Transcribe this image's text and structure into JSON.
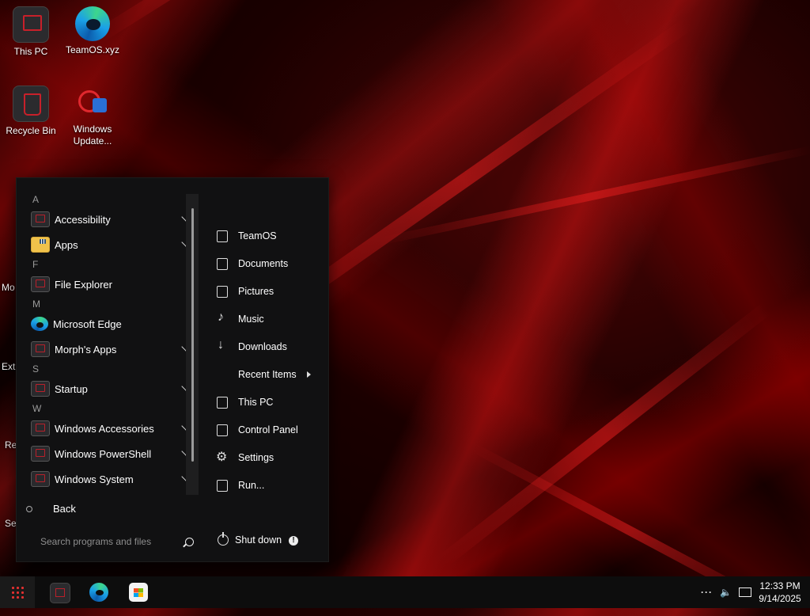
{
  "desktop": {
    "icons": [
      {
        "label": "This PC",
        "icon": "pc-icon"
      },
      {
        "label": "TeamOS.xyz",
        "icon": "edge-icon"
      },
      {
        "label": "Recycle Bin",
        "icon": "recycle-bin-icon"
      },
      {
        "label": "Windows Update...",
        "icon": "windows-update-icon"
      }
    ],
    "partial_labels": [
      "Mo",
      "Extr",
      "Re",
      "Se"
    ]
  },
  "start_menu": {
    "groups": [
      {
        "letter": "A",
        "items": [
          {
            "label": "Accessibility",
            "icon": "folder-icon",
            "expandable": true
          },
          {
            "label": "Apps",
            "icon": "folder-icon",
            "expandable": true
          }
        ]
      },
      {
        "letter": "F",
        "items": [
          {
            "label": "File Explorer",
            "icon": "file-explorer-icon",
            "expandable": false
          }
        ]
      },
      {
        "letter": "M",
        "items": [
          {
            "label": "Microsoft Edge",
            "icon": "edge-icon",
            "expandable": false
          },
          {
            "label": "Morph's Apps",
            "icon": "folder-icon",
            "expandable": true
          }
        ]
      },
      {
        "letter": "S",
        "items": [
          {
            "label": "Startup",
            "icon": "folder-icon",
            "expandable": true
          }
        ]
      },
      {
        "letter": "W",
        "items": [
          {
            "label": "Windows Accessories",
            "icon": "folder-icon",
            "expandable": true
          },
          {
            "label": "Windows PowerShell",
            "icon": "folder-icon",
            "expandable": true
          },
          {
            "label": "Windows System",
            "icon": "folder-icon",
            "expandable": true
          }
        ]
      }
    ],
    "back_label": "Back",
    "search_placeholder": "Search programs and files",
    "right_items": [
      {
        "label": "TeamOS",
        "icon": "user-folder-icon"
      },
      {
        "label": "Documents",
        "icon": "document-icon"
      },
      {
        "label": "Pictures",
        "icon": "picture-icon"
      },
      {
        "label": "Music",
        "icon": "music-icon"
      },
      {
        "label": "Downloads",
        "icon": "download-icon"
      },
      {
        "label": "Recent Items",
        "icon": "clock-icon",
        "submenu": true
      },
      {
        "label": "This PC",
        "icon": "pc-icon"
      },
      {
        "label": "Control Panel",
        "icon": "control-panel-icon"
      },
      {
        "label": "Settings",
        "icon": "gear-icon"
      },
      {
        "label": "Run...",
        "icon": "run-icon"
      }
    ],
    "shutdown_label": "Shut down",
    "info_glyph": "!"
  },
  "taskbar": {
    "pinned": [
      "file-explorer-icon",
      "edge-icon",
      "store-icon"
    ],
    "tray_overflow": "···",
    "volume_glyph": "🔈",
    "time": "12:33 PM",
    "date": "9/14/2025"
  }
}
